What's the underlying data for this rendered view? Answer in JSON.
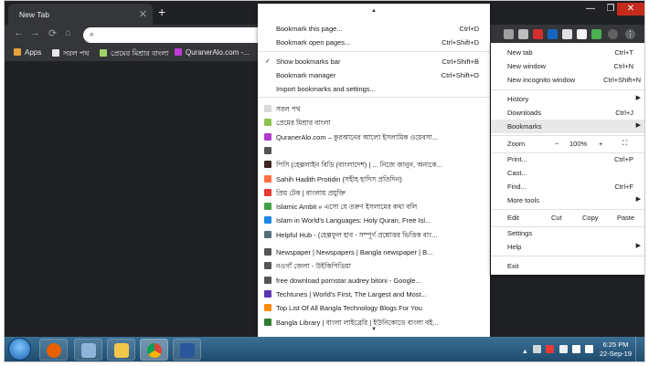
{
  "tab": {
    "title": "New Tab"
  },
  "window_controls": {
    "minimize": "—",
    "maximize": "❐",
    "close": "✕"
  },
  "bookmarks_bar": {
    "apps_label": "Apps",
    "items": [
      {
        "label": "সরল পথ",
        "color": "#e8e8e8"
      },
      {
        "label": "প্রেমের মিশ্রার বাংলা",
        "color": "#a0d468"
      },
      {
        "label": "QuranerAlo.com -...",
        "color": "#c03ad6"
      }
    ]
  },
  "bookmarks_submenu": {
    "actions": [
      {
        "label": "Bookmark this page...",
        "shortcut": "Ctrl+D"
      },
      {
        "label": "Bookmark open pages...",
        "shortcut": "Ctrl+Shift+D"
      }
    ],
    "bar_actions": [
      {
        "label": "Show bookmarks bar",
        "shortcut": "Ctrl+Shift+B",
        "checked": true
      },
      {
        "label": "Bookmark manager",
        "shortcut": "Ctrl+Shift+O"
      },
      {
        "label": "Import bookmarks and settings...",
        "shortcut": ""
      }
    ],
    "bookmarks": [
      {
        "label": "সরল পথ",
        "icon": "#d9d9d9"
      },
      {
        "label": "প্রেমের মিশ্রার বাংলা",
        "icon": "#8bc34a"
      },
      {
        "label": "QuranerAlo.com – কুরআনের আলো ইসলামিক ওয়েবসা...",
        "icon": "#b03ad0"
      },
      {
        "label": "",
        "icon": "#555555"
      },
      {
        "label": "পিসি (হেল্পলাইন বিডি (বাংলাদেশ) | ... নিজে জানুন, অন্যকে...",
        "icon": "#3e2723"
      },
      {
        "label": "Sahih Hadith Protidin (সহীহ হাদিস প্রতিদিন)",
        "icon": "#ff7043"
      },
      {
        "label": "প্রিয় টেক | বাংলায় প্রযুক্তি",
        "icon": "#e53935"
      },
      {
        "label": "Islamic Ambit » এসো যে তরুণ ইসলামের কথা বলি",
        "icon": "#43a047"
      },
      {
        "label": "Islam in World's Languages: Holy Quran, Free Isl...",
        "icon": "#1e88e5"
      },
      {
        "label": "Helpful Hub - (হেল্পফুল হাব - সম্পূর্ণ প্রশ্নোত্তর ভিত্তিক বাং...",
        "icon": "#546e7a"
      },
      {
        "label": "Newspaper | Newspapers | Bangla newspaper | B...",
        "icon": "#555555"
      },
      {
        "label": "নওগাঁ জেলা - উইকিপিডিয়া",
        "icon": "#555555"
      },
      {
        "label": "free download pornstar audrey bitoni - Google...",
        "icon": "#555555"
      },
      {
        "label": "Techtunes | World's First, The Largest and Most...",
        "icon": "#5e35b1"
      },
      {
        "label": "Top List Of All Bangla Technology Blogs For You",
        "icon": "#fb8c00"
      },
      {
        "label": "Bangla Library | বাংলা লাইব্রেরি | ইউনিকোডে বাংলা বই...",
        "icon": "#2e7d32"
      }
    ]
  },
  "main_menu": {
    "group1": [
      {
        "label": "New tab",
        "shortcut": "Ctrl+T"
      },
      {
        "label": "New window",
        "shortcut": "Ctrl+N"
      },
      {
        "label": "New incognito window",
        "shortcut": "Ctrl+Shift+N"
      }
    ],
    "group2": [
      {
        "label": "History",
        "shortcut": "",
        "submenu": true
      },
      {
        "label": "Downloads",
        "shortcut": "Ctrl+J",
        "submenu": false
      },
      {
        "label": "Bookmarks",
        "shortcut": "",
        "submenu": true,
        "highlight": true
      }
    ],
    "zoom": {
      "label": "Zoom",
      "minus": "−",
      "value": "100%",
      "plus": "+",
      "fullscreen": "⛶"
    },
    "group3": [
      {
        "label": "Print...",
        "shortcut": "Ctrl+P",
        "submenu": false
      },
      {
        "label": "Cast...",
        "shortcut": "",
        "submenu": false
      },
      {
        "label": "Find...",
        "shortcut": "Ctrl+F",
        "submenu": false
      },
      {
        "label": "More tools",
        "shortcut": "",
        "submenu": true
      }
    ],
    "edit": {
      "label": "Edit",
      "cut": "Cut",
      "copy": "Copy",
      "paste": "Paste"
    },
    "group4": [
      {
        "label": "Settings",
        "submenu": false
      },
      {
        "label": "Help",
        "submenu": true
      }
    ],
    "exit": "Exit"
  },
  "taskbar": {
    "clock_time": "6:25 PM",
    "clock_date": "22-Sep-19"
  }
}
